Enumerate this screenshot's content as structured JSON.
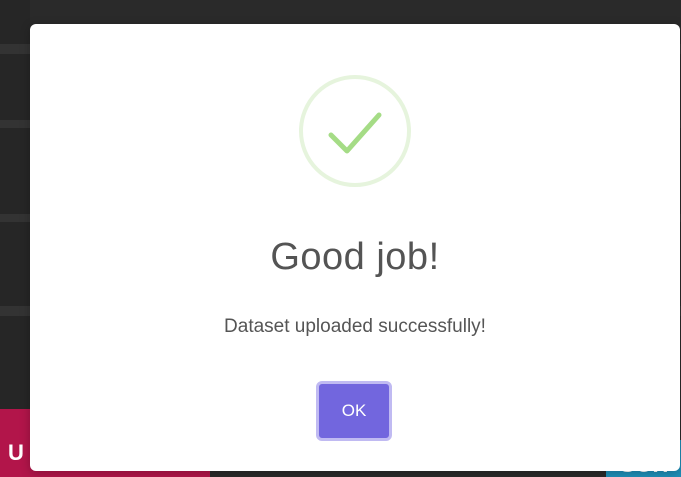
{
  "background": {
    "left_button_text": "U",
    "right_button_text": "SCH"
  },
  "dialog": {
    "icon": "checkmark-icon",
    "title": "Good job!",
    "message": "Dataset uploaded successfully!",
    "confirm_label": "OK"
  },
  "colors": {
    "confirm_button": "#7266de",
    "confirm_button_ring": "#c0baf2",
    "checkmark": "#a5dc86",
    "checkmark_ring": "#e6f4dd",
    "overlay": "#2a2a2a",
    "background_button_pink": "#b2154a",
    "background_button_teal": "#1e8fb8"
  }
}
